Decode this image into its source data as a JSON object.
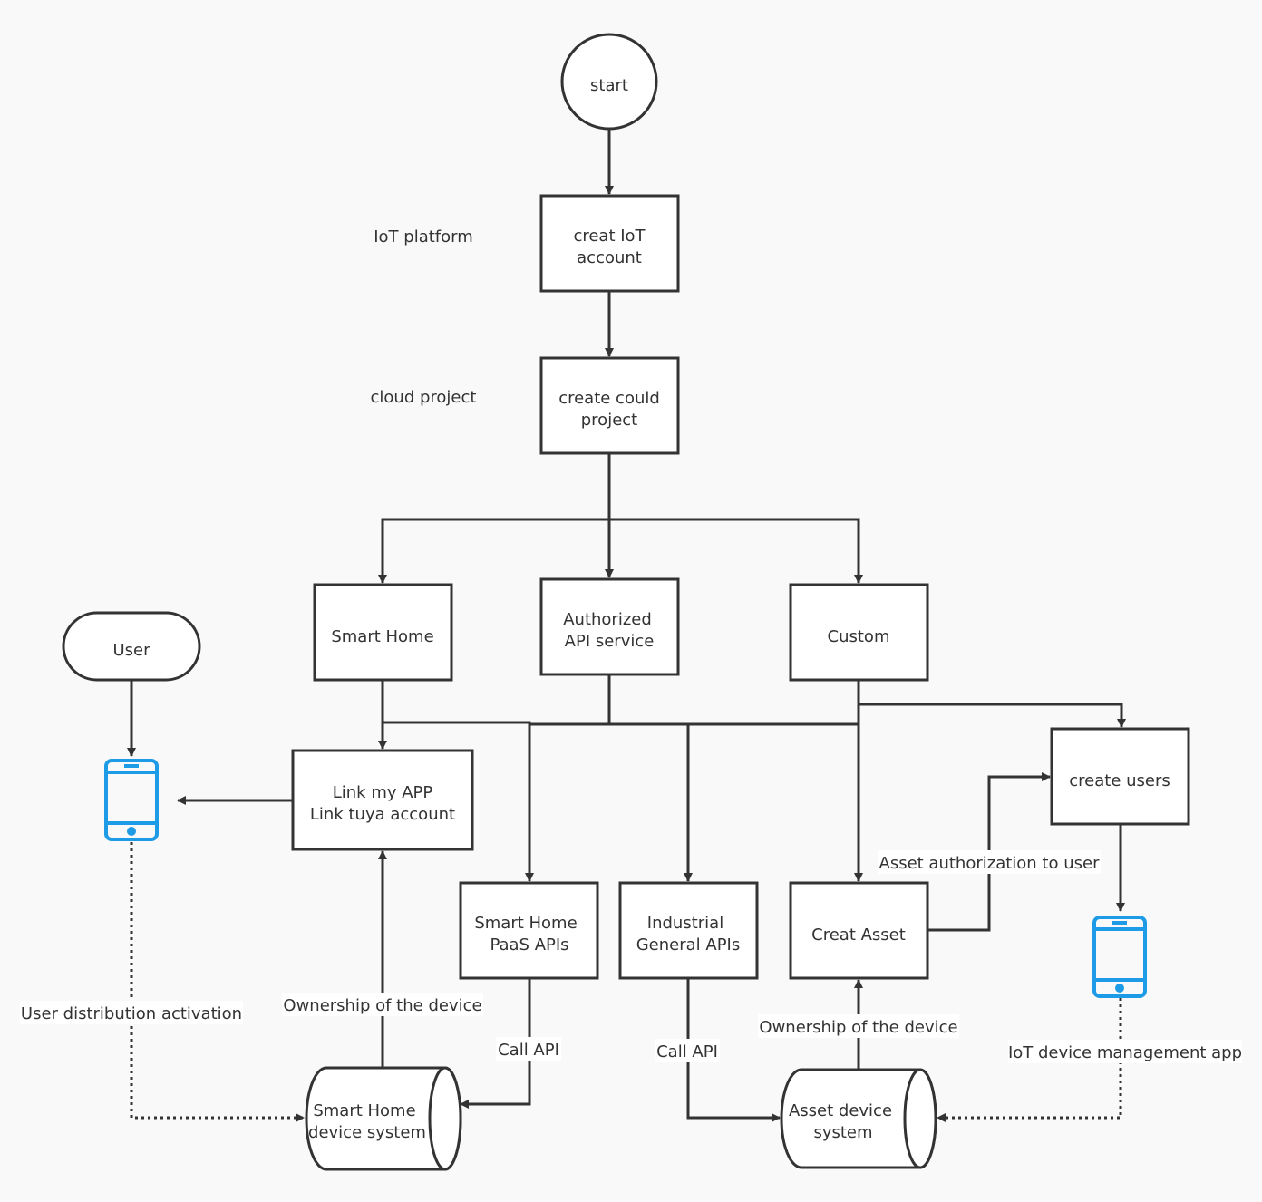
{
  "nodes": {
    "start": "start",
    "creat_iot_account": [
      "creat IoT",
      "account"
    ],
    "create_cloud_project": [
      "create could",
      "project"
    ],
    "smart_home": "Smart Home",
    "authorized_api": [
      "Authorized",
      "API service"
    ],
    "custom": "Custom",
    "user": "User",
    "link_app": [
      "Link my APP",
      "Link tuya account"
    ],
    "create_users": "create users",
    "smart_home_paas": [
      "Smart Home",
      "PaaS APIs"
    ],
    "industrial_apis": [
      "Industrial",
      "General APIs"
    ],
    "creat_asset": "Creat Asset",
    "smart_home_device_system": [
      "Smart Home",
      "device system"
    ],
    "asset_device_system": [
      "Asset device",
      "system"
    ]
  },
  "labels": {
    "iot_platform": "IoT platform",
    "cloud_project": "cloud project",
    "user_distribution": "User distribution activation",
    "ownership_left": "Ownership of the device",
    "call_api_left": "Call API",
    "call_api_right": "Call API",
    "ownership_right": "Ownership of the device",
    "asset_authorization": "Asset authorization to user",
    "iot_mgmt_app": "IoT device management app"
  },
  "icons": {
    "phone_user": "mobile-phone-icon",
    "phone_mgmt": "mobile-phone-icon"
  },
  "colors": {
    "icon": "#1e9be6",
    "stroke": "#333333",
    "background": "#f9f9f9"
  }
}
